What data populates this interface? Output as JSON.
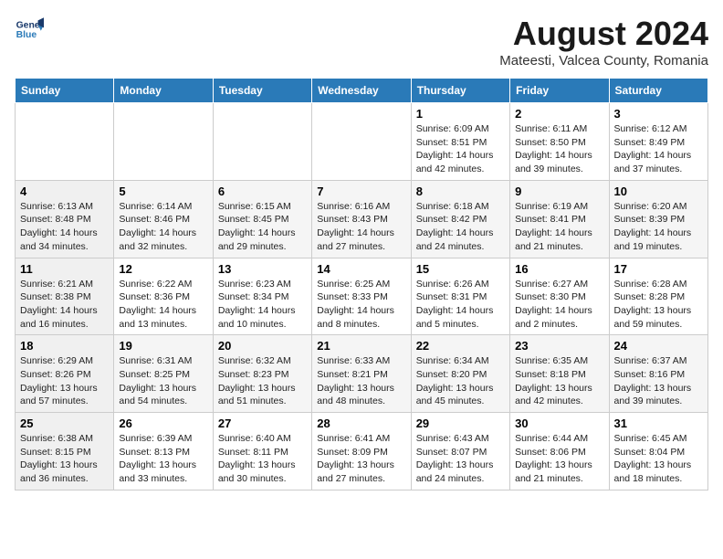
{
  "header": {
    "logo_line1": "General",
    "logo_line2": "Blue",
    "month": "August 2024",
    "location": "Mateesti, Valcea County, Romania"
  },
  "days_of_week": [
    "Sunday",
    "Monday",
    "Tuesday",
    "Wednesday",
    "Thursday",
    "Friday",
    "Saturday"
  ],
  "weeks": [
    [
      {
        "day": "",
        "info": ""
      },
      {
        "day": "",
        "info": ""
      },
      {
        "day": "",
        "info": ""
      },
      {
        "day": "",
        "info": ""
      },
      {
        "day": "1",
        "info": "Sunrise: 6:09 AM\nSunset: 8:51 PM\nDaylight: 14 hours\nand 42 minutes."
      },
      {
        "day": "2",
        "info": "Sunrise: 6:11 AM\nSunset: 8:50 PM\nDaylight: 14 hours\nand 39 minutes."
      },
      {
        "day": "3",
        "info": "Sunrise: 6:12 AM\nSunset: 8:49 PM\nDaylight: 14 hours\nand 37 minutes."
      }
    ],
    [
      {
        "day": "4",
        "info": "Sunrise: 6:13 AM\nSunset: 8:48 PM\nDaylight: 14 hours\nand 34 minutes."
      },
      {
        "day": "5",
        "info": "Sunrise: 6:14 AM\nSunset: 8:46 PM\nDaylight: 14 hours\nand 32 minutes."
      },
      {
        "day": "6",
        "info": "Sunrise: 6:15 AM\nSunset: 8:45 PM\nDaylight: 14 hours\nand 29 minutes."
      },
      {
        "day": "7",
        "info": "Sunrise: 6:16 AM\nSunset: 8:43 PM\nDaylight: 14 hours\nand 27 minutes."
      },
      {
        "day": "8",
        "info": "Sunrise: 6:18 AM\nSunset: 8:42 PM\nDaylight: 14 hours\nand 24 minutes."
      },
      {
        "day": "9",
        "info": "Sunrise: 6:19 AM\nSunset: 8:41 PM\nDaylight: 14 hours\nand 21 minutes."
      },
      {
        "day": "10",
        "info": "Sunrise: 6:20 AM\nSunset: 8:39 PM\nDaylight: 14 hours\nand 19 minutes."
      }
    ],
    [
      {
        "day": "11",
        "info": "Sunrise: 6:21 AM\nSunset: 8:38 PM\nDaylight: 14 hours\nand 16 minutes."
      },
      {
        "day": "12",
        "info": "Sunrise: 6:22 AM\nSunset: 8:36 PM\nDaylight: 14 hours\nand 13 minutes."
      },
      {
        "day": "13",
        "info": "Sunrise: 6:23 AM\nSunset: 8:34 PM\nDaylight: 14 hours\nand 10 minutes."
      },
      {
        "day": "14",
        "info": "Sunrise: 6:25 AM\nSunset: 8:33 PM\nDaylight: 14 hours\nand 8 minutes."
      },
      {
        "day": "15",
        "info": "Sunrise: 6:26 AM\nSunset: 8:31 PM\nDaylight: 14 hours\nand 5 minutes."
      },
      {
        "day": "16",
        "info": "Sunrise: 6:27 AM\nSunset: 8:30 PM\nDaylight: 14 hours\nand 2 minutes."
      },
      {
        "day": "17",
        "info": "Sunrise: 6:28 AM\nSunset: 8:28 PM\nDaylight: 13 hours\nand 59 minutes."
      }
    ],
    [
      {
        "day": "18",
        "info": "Sunrise: 6:29 AM\nSunset: 8:26 PM\nDaylight: 13 hours\nand 57 minutes."
      },
      {
        "day": "19",
        "info": "Sunrise: 6:31 AM\nSunset: 8:25 PM\nDaylight: 13 hours\nand 54 minutes."
      },
      {
        "day": "20",
        "info": "Sunrise: 6:32 AM\nSunset: 8:23 PM\nDaylight: 13 hours\nand 51 minutes."
      },
      {
        "day": "21",
        "info": "Sunrise: 6:33 AM\nSunset: 8:21 PM\nDaylight: 13 hours\nand 48 minutes."
      },
      {
        "day": "22",
        "info": "Sunrise: 6:34 AM\nSunset: 8:20 PM\nDaylight: 13 hours\nand 45 minutes."
      },
      {
        "day": "23",
        "info": "Sunrise: 6:35 AM\nSunset: 8:18 PM\nDaylight: 13 hours\nand 42 minutes."
      },
      {
        "day": "24",
        "info": "Sunrise: 6:37 AM\nSunset: 8:16 PM\nDaylight: 13 hours\nand 39 minutes."
      }
    ],
    [
      {
        "day": "25",
        "info": "Sunrise: 6:38 AM\nSunset: 8:15 PM\nDaylight: 13 hours\nand 36 minutes."
      },
      {
        "day": "26",
        "info": "Sunrise: 6:39 AM\nSunset: 8:13 PM\nDaylight: 13 hours\nand 33 minutes."
      },
      {
        "day": "27",
        "info": "Sunrise: 6:40 AM\nSunset: 8:11 PM\nDaylight: 13 hours\nand 30 minutes."
      },
      {
        "day": "28",
        "info": "Sunrise: 6:41 AM\nSunset: 8:09 PM\nDaylight: 13 hours\nand 27 minutes."
      },
      {
        "day": "29",
        "info": "Sunrise: 6:43 AM\nSunset: 8:07 PM\nDaylight: 13 hours\nand 24 minutes."
      },
      {
        "day": "30",
        "info": "Sunrise: 6:44 AM\nSunset: 8:06 PM\nDaylight: 13 hours\nand 21 minutes."
      },
      {
        "day": "31",
        "info": "Sunrise: 6:45 AM\nSunset: 8:04 PM\nDaylight: 13 hours\nand 18 minutes."
      }
    ]
  ]
}
